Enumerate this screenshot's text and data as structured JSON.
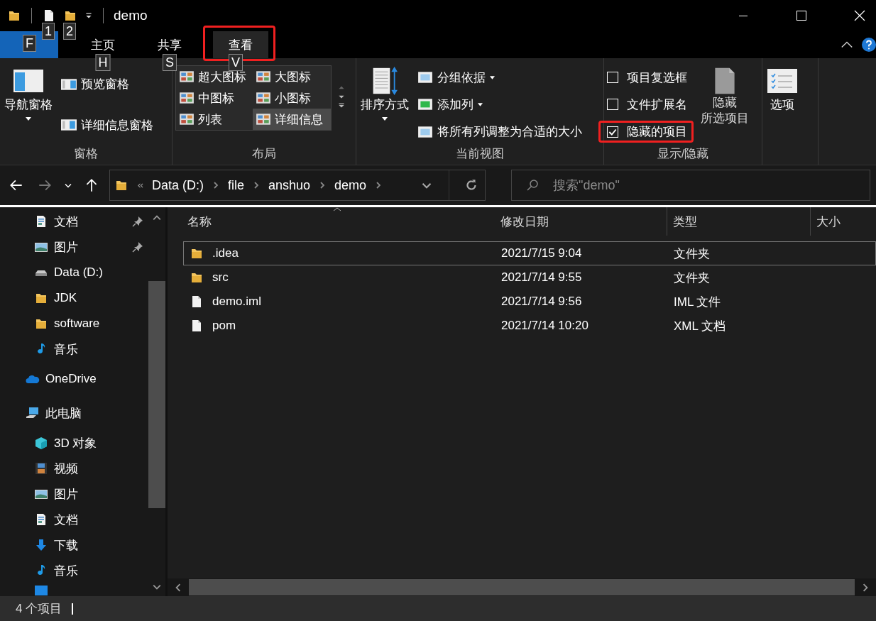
{
  "title_bar": {
    "title": "demo",
    "quick_access_keytips": [
      "1",
      "2"
    ]
  },
  "ribbon_tabs": [
    {
      "keytip": "F",
      "selected": false,
      "kind": "menu",
      "highlighted": false
    },
    {
      "label": "主页",
      "keytip": "H",
      "selected": false,
      "kind": "tab",
      "highlighted": false
    },
    {
      "label": "共享",
      "keytip": "S",
      "selected": false,
      "kind": "tab",
      "highlighted": false
    },
    {
      "label": "查看",
      "keytip": "V",
      "selected": true,
      "kind": "tab",
      "highlighted": true
    }
  ],
  "ribbon": {
    "panes": {
      "label": "窗格",
      "nav_pane": "导航窗格",
      "items": [
        "预览窗格",
        "详细信息窗格"
      ]
    },
    "layout": {
      "label": "布局",
      "options": [
        {
          "label": "超大图标",
          "selected": false
        },
        {
          "label": "大图标",
          "selected": false
        },
        {
          "label": "中图标",
          "selected": false
        },
        {
          "label": "小图标",
          "selected": false
        },
        {
          "label": "列表",
          "selected": false
        },
        {
          "label": "详细信息",
          "selected": true
        }
      ]
    },
    "current_view": {
      "label": "当前视图",
      "sort": "排序方式",
      "items": [
        {
          "label": "分组依据",
          "dropdown": true
        },
        {
          "label": "添加列",
          "dropdown": true
        },
        {
          "label": "将所有列调整为合适的大小",
          "dropdown": false
        }
      ]
    },
    "show_hide": {
      "label": "显示/隐藏",
      "checkboxes": [
        {
          "label": "项目复选框",
          "checked": false,
          "highlighted": false
        },
        {
          "label": "文件扩展名",
          "checked": false,
          "highlighted": false
        },
        {
          "label": "隐藏的项目",
          "checked": true,
          "highlighted": true
        }
      ],
      "hide_selected": [
        "隐藏",
        "所选项目"
      ]
    },
    "options": {
      "label": "选项"
    }
  },
  "address_bar": {
    "path": [
      "Data (D:)",
      "file",
      "anshuo",
      "demo"
    ],
    "search_placeholder": "搜索\"demo\""
  },
  "sidebar": {
    "quick_access_children": [
      {
        "label": "文档",
        "kind": "doc",
        "pinned": true
      },
      {
        "label": "图片",
        "kind": "image",
        "pinned": true
      },
      {
        "label": "Data (D:)",
        "kind": "drive",
        "pinned": false
      },
      {
        "label": "JDK",
        "kind": "folder",
        "pinned": false
      },
      {
        "label": "software",
        "kind": "folder",
        "pinned": false
      },
      {
        "label": "音乐",
        "kind": "music",
        "pinned": false
      }
    ],
    "items": [
      {
        "label": "OneDrive",
        "kind": "cloud"
      },
      {
        "label": "此电脑",
        "kind": "pc",
        "children": [
          {
            "label": "3D 对象",
            "kind": "cube"
          },
          {
            "label": "视频",
            "kind": "video"
          },
          {
            "label": "图片",
            "kind": "image"
          },
          {
            "label": "文档",
            "kind": "doc"
          },
          {
            "label": "下载",
            "kind": "download"
          },
          {
            "label": "音乐",
            "kind": "music"
          }
        ]
      }
    ]
  },
  "file_list": {
    "columns": [
      "名称",
      "修改日期",
      "类型",
      "大小"
    ],
    "rows": [
      {
        "name": ".idea",
        "date": "2021/7/15 9:04",
        "type": "文件夹",
        "kind": "folder",
        "selected": true
      },
      {
        "name": "src",
        "date": "2021/7/14 9:55",
        "type": "文件夹",
        "kind": "folder",
        "selected": false
      },
      {
        "name": "demo.iml",
        "date": "2021/7/14 9:56",
        "type": "IML 文件",
        "kind": "file",
        "selected": false
      },
      {
        "name": "pom",
        "date": "2021/7/14 10:20",
        "type": "XML 文档",
        "kind": "file",
        "selected": false
      }
    ]
  },
  "status_bar": {
    "count": "4 个项目"
  }
}
